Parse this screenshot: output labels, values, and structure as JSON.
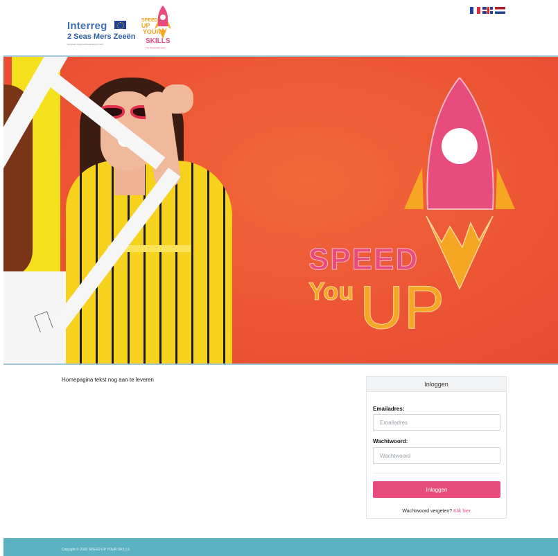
{
  "header": {
    "interreg": {
      "name": "Interreg",
      "program": "2 Seas Mers Zeeën",
      "fund": "European Regional Development Fund"
    },
    "speed_logo": {
      "line1": "SPEED",
      "line2": "UP",
      "line3": "YOUR",
      "line4": "SKILLS",
      "tagline": "The Peopleskill quest"
    },
    "languages": [
      "fr",
      "en",
      "nl"
    ]
  },
  "banner": {
    "speed": "SPEED",
    "you": "You",
    "up": "UP"
  },
  "main": {
    "home_text": "Homepagina tekst nog aan te leveren"
  },
  "login": {
    "title": "Inloggen",
    "email_label": "Emailadres:",
    "email_placeholder": "Emailadres",
    "email_value": "",
    "password_label": "Wachtwoord:",
    "password_placeholder": "Wachtwoord",
    "password_value": "",
    "submit_label": "Inloggen",
    "forgot_text": "Wachtwoord vergeten?",
    "forgot_link": "Klik hier."
  },
  "footer": {
    "copyright": "Copyight © 2020 SPEED UP YOUR SKILLS"
  },
  "colors": {
    "accent": "#e84c7d",
    "orange": "#f5a623",
    "banner": "#ee5a35",
    "footer": "#5bb3c2"
  }
}
